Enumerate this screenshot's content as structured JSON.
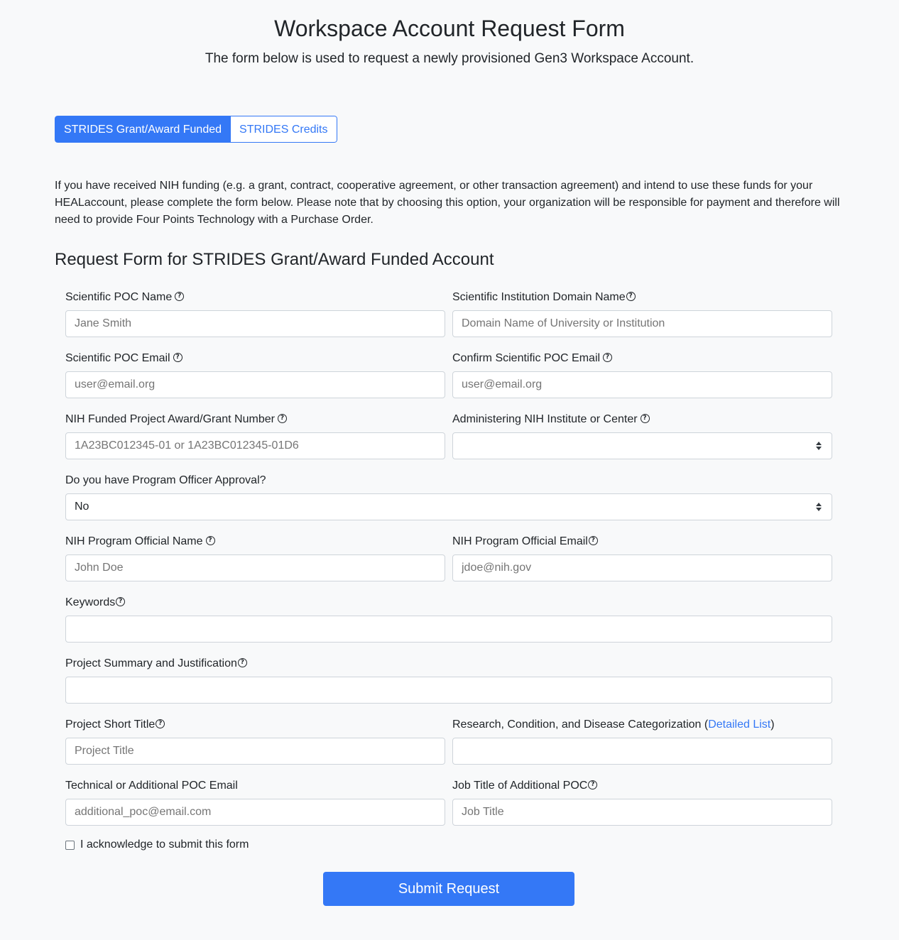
{
  "header": {
    "title": "Workspace Account Request Form",
    "subtitle": "The form below is used to request a newly provisioned Gen3 Workspace Account."
  },
  "toggle": {
    "active_label": "STRIDES Grant/Award Funded",
    "inactive_label": "STRIDES Credits"
  },
  "intro": "If you have received NIH funding (e.g. a grant, contract, cooperative agreement, or other transaction agreement) and intend to use these funds for your HEALaccount, please complete the form below. Please note that by choosing this option, your organization will be responsible for payment and therefore will need to provide Four Points Technology with a Purchase Order.",
  "section_title": "Request Form for STRIDES Grant/Award Funded Account",
  "fields": {
    "poc_name": {
      "label": "Scientific POC Name",
      "placeholder": "Jane Smith"
    },
    "domain": {
      "label": "Scientific Institution Domain Name",
      "placeholder": "Domain Name of University or Institution"
    },
    "poc_email": {
      "label": "Scientific POC Email",
      "placeholder": "user@email.org"
    },
    "confirm_email": {
      "label": "Confirm Scientific POC Email",
      "placeholder": "user@email.org"
    },
    "grant_number": {
      "label": "NIH Funded Project Award/Grant Number",
      "placeholder": "1A23BC012345-01 or 1A23BC012345-01D6"
    },
    "institute": {
      "label": "Administering NIH Institute or Center",
      "value": ""
    },
    "approval": {
      "label": "Do you have Program Officer Approval?",
      "value": "No"
    },
    "official_name": {
      "label": "NIH Program Official Name",
      "placeholder": "John Doe"
    },
    "official_email": {
      "label": "NIH Program Official Email",
      "placeholder": "jdoe@nih.gov"
    },
    "keywords": {
      "label": "Keywords",
      "placeholder": ""
    },
    "summary": {
      "label": "Project Summary and Justification",
      "placeholder": ""
    },
    "short_title": {
      "label": "Project Short Title",
      "placeholder": "Project Title"
    },
    "rcdc": {
      "label_prefix": "Research, Condition, and Disease Categorization (",
      "link": "Detailed List",
      "label_suffix": ")",
      "placeholder": ""
    },
    "additional_email": {
      "label": "Technical or Additional POC Email",
      "placeholder": "additional_poc@email.com"
    },
    "job_title": {
      "label": "Job Title of Additional POC",
      "placeholder": "Job Title"
    }
  },
  "acknowledge": "I acknowledge to submit this form",
  "submit_label": "Submit Request",
  "help_icon": "question-circle-icon",
  "colors": {
    "primary": "#3478f6",
    "background": "#f8f9fa",
    "border": "#ced4da"
  }
}
